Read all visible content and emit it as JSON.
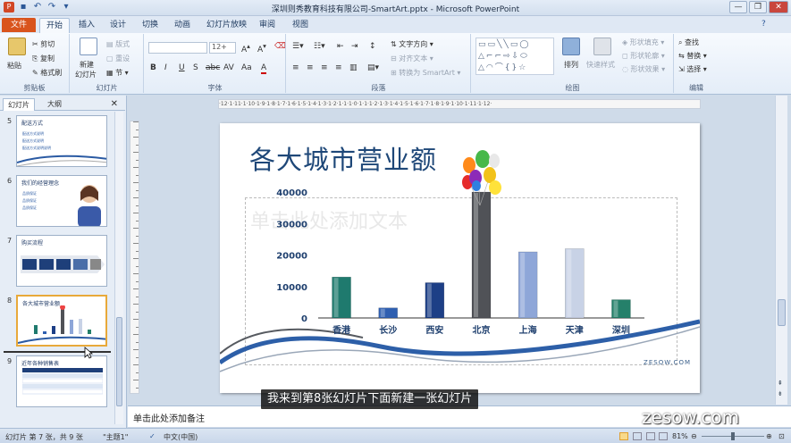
{
  "window": {
    "title": "深圳则秀教育科技有限公司-SmartArt.pptx - Microsoft PowerPoint",
    "controls": {
      "minimize": "—",
      "restore": "❐",
      "close": "✕"
    }
  },
  "tabs": [
    {
      "label": "文件"
    },
    {
      "label": "开始"
    },
    {
      "label": "插入"
    },
    {
      "label": "设计"
    },
    {
      "label": "切换"
    },
    {
      "label": "动画"
    },
    {
      "label": "幻灯片放映"
    },
    {
      "label": "审阅"
    },
    {
      "label": "视图"
    }
  ],
  "ribbon": {
    "clipboard": {
      "label": "剪贴板",
      "paste": "粘贴",
      "cut": "剪切",
      "copy": "复制",
      "format_painter": "格式刷"
    },
    "slides": {
      "label": "幻灯片",
      "new_slide": "新建",
      "new_slide2": "幻灯片",
      "layout": "版式",
      "reset": "重设",
      "section": "节"
    },
    "font": {
      "label": "字体",
      "size": "12+",
      "buttons": [
        "B",
        "I",
        "U",
        "S",
        "abc",
        "AV",
        "Aa",
        "A"
      ]
    },
    "paragraph": {
      "label": "段落",
      "text_direction": "文字方向",
      "align_text": "对齐文本",
      "convert_smartart": "转换为 SmartArt"
    },
    "drawing": {
      "label": "绘图",
      "arrange": "排列",
      "quick_styles": "快速样式",
      "shape_fill": "形状填充",
      "shape_outline": "形状轮廓",
      "shape_effects": "形状效果"
    },
    "editing": {
      "label": "编辑",
      "find": "查找",
      "replace": "替换",
      "select": "选择"
    }
  },
  "panel": {
    "tabs": [
      "幻灯片",
      "大纲"
    ],
    "close": "✕",
    "thumbs": [
      {
        "num": "5",
        "title": "配送方式",
        "lines": [
          "配送方式说明",
          "配送方式说明",
          "配送方式说明说明"
        ]
      },
      {
        "num": "6",
        "title": "我们的经营理念",
        "lines": [
          "品质保证",
          "品质保证",
          "品质保证"
        ]
      },
      {
        "num": "7",
        "title": "购买流程",
        "lines": []
      },
      {
        "num": "8",
        "title": "各大城市营业额",
        "lines": []
      },
      {
        "num": "9",
        "title": "近年各种销售表",
        "lines": []
      }
    ]
  },
  "ruler": {
    "marks": "·12·1·11·1·10·1·9·1·8·1·7·1·6·1·5·1·4·1·3·1·2·1·1·1·0·1·1·1·2·1·3·1·4·1·5·1·6·1·7·1·8·1·9·1·10·1·11·1·12·"
  },
  "slide": {
    "title": "各大城市营业额",
    "placeholder": "单击此处添加文本",
    "brand": "ZESOW.COM"
  },
  "chart_data": {
    "type": "bar",
    "categories": [
      "香港",
      "长沙",
      "西安",
      "北京",
      "上海",
      "天津",
      "深圳"
    ],
    "values": [
      13000,
      3200,
      11200,
      40000,
      21000,
      22000,
      5800
    ],
    "colors": [
      "#1f7a6e",
      "#2f5fb0",
      "#1d3f86",
      "#505257",
      "#8ea6d8",
      "#c8d2e6",
      "#25806a"
    ],
    "yticks": [
      "0",
      "10000",
      "20000",
      "30000",
      "40000"
    ],
    "ylim": [
      0,
      40000
    ]
  },
  "notes": {
    "placeholder": "单击此处添加备注"
  },
  "subtitle": "我来到第8张幻灯片下面新建一张幻灯片",
  "watermark": "zesow.com",
  "status": {
    "slide_info": "幻灯片 第 7 张，共 9 张",
    "theme": "\"主题1\"",
    "lang": "中文(中国)",
    "zoom": "81%"
  }
}
